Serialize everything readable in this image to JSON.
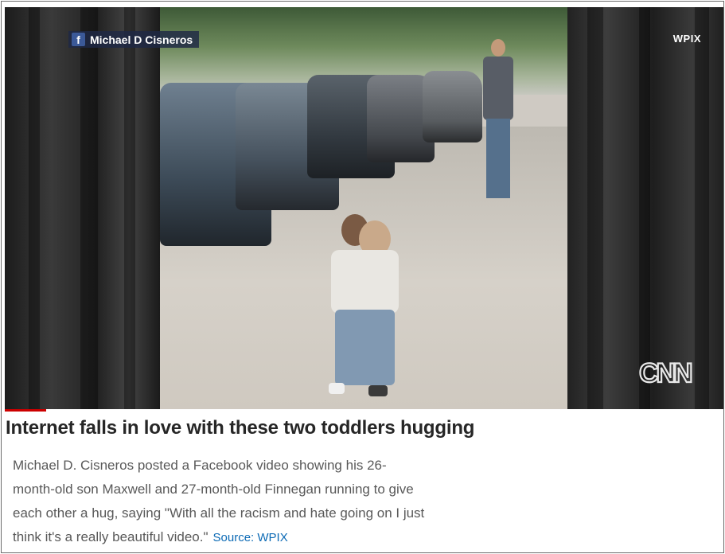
{
  "video": {
    "facebook_credit": "Michael D Cisneros",
    "channel_bug": "WPIX",
    "network_logo": "CNN",
    "facebook_icon": "facebook-icon"
  },
  "article": {
    "headline": "Internet falls in love with these two toddlers hugging",
    "description": "Michael D. Cisneros posted a Facebook video showing his 26-month-old son Maxwell and 27-month-old Finnegan running to give each other a hug, saying \"With all the racism and hate going on I just think it's a really beautiful video.\"",
    "source_label": "Source: WPIX"
  },
  "colors": {
    "accent_red": "#cc0000",
    "source_link": "#0c6ab5",
    "facebook_blue": "#3b5998"
  }
}
